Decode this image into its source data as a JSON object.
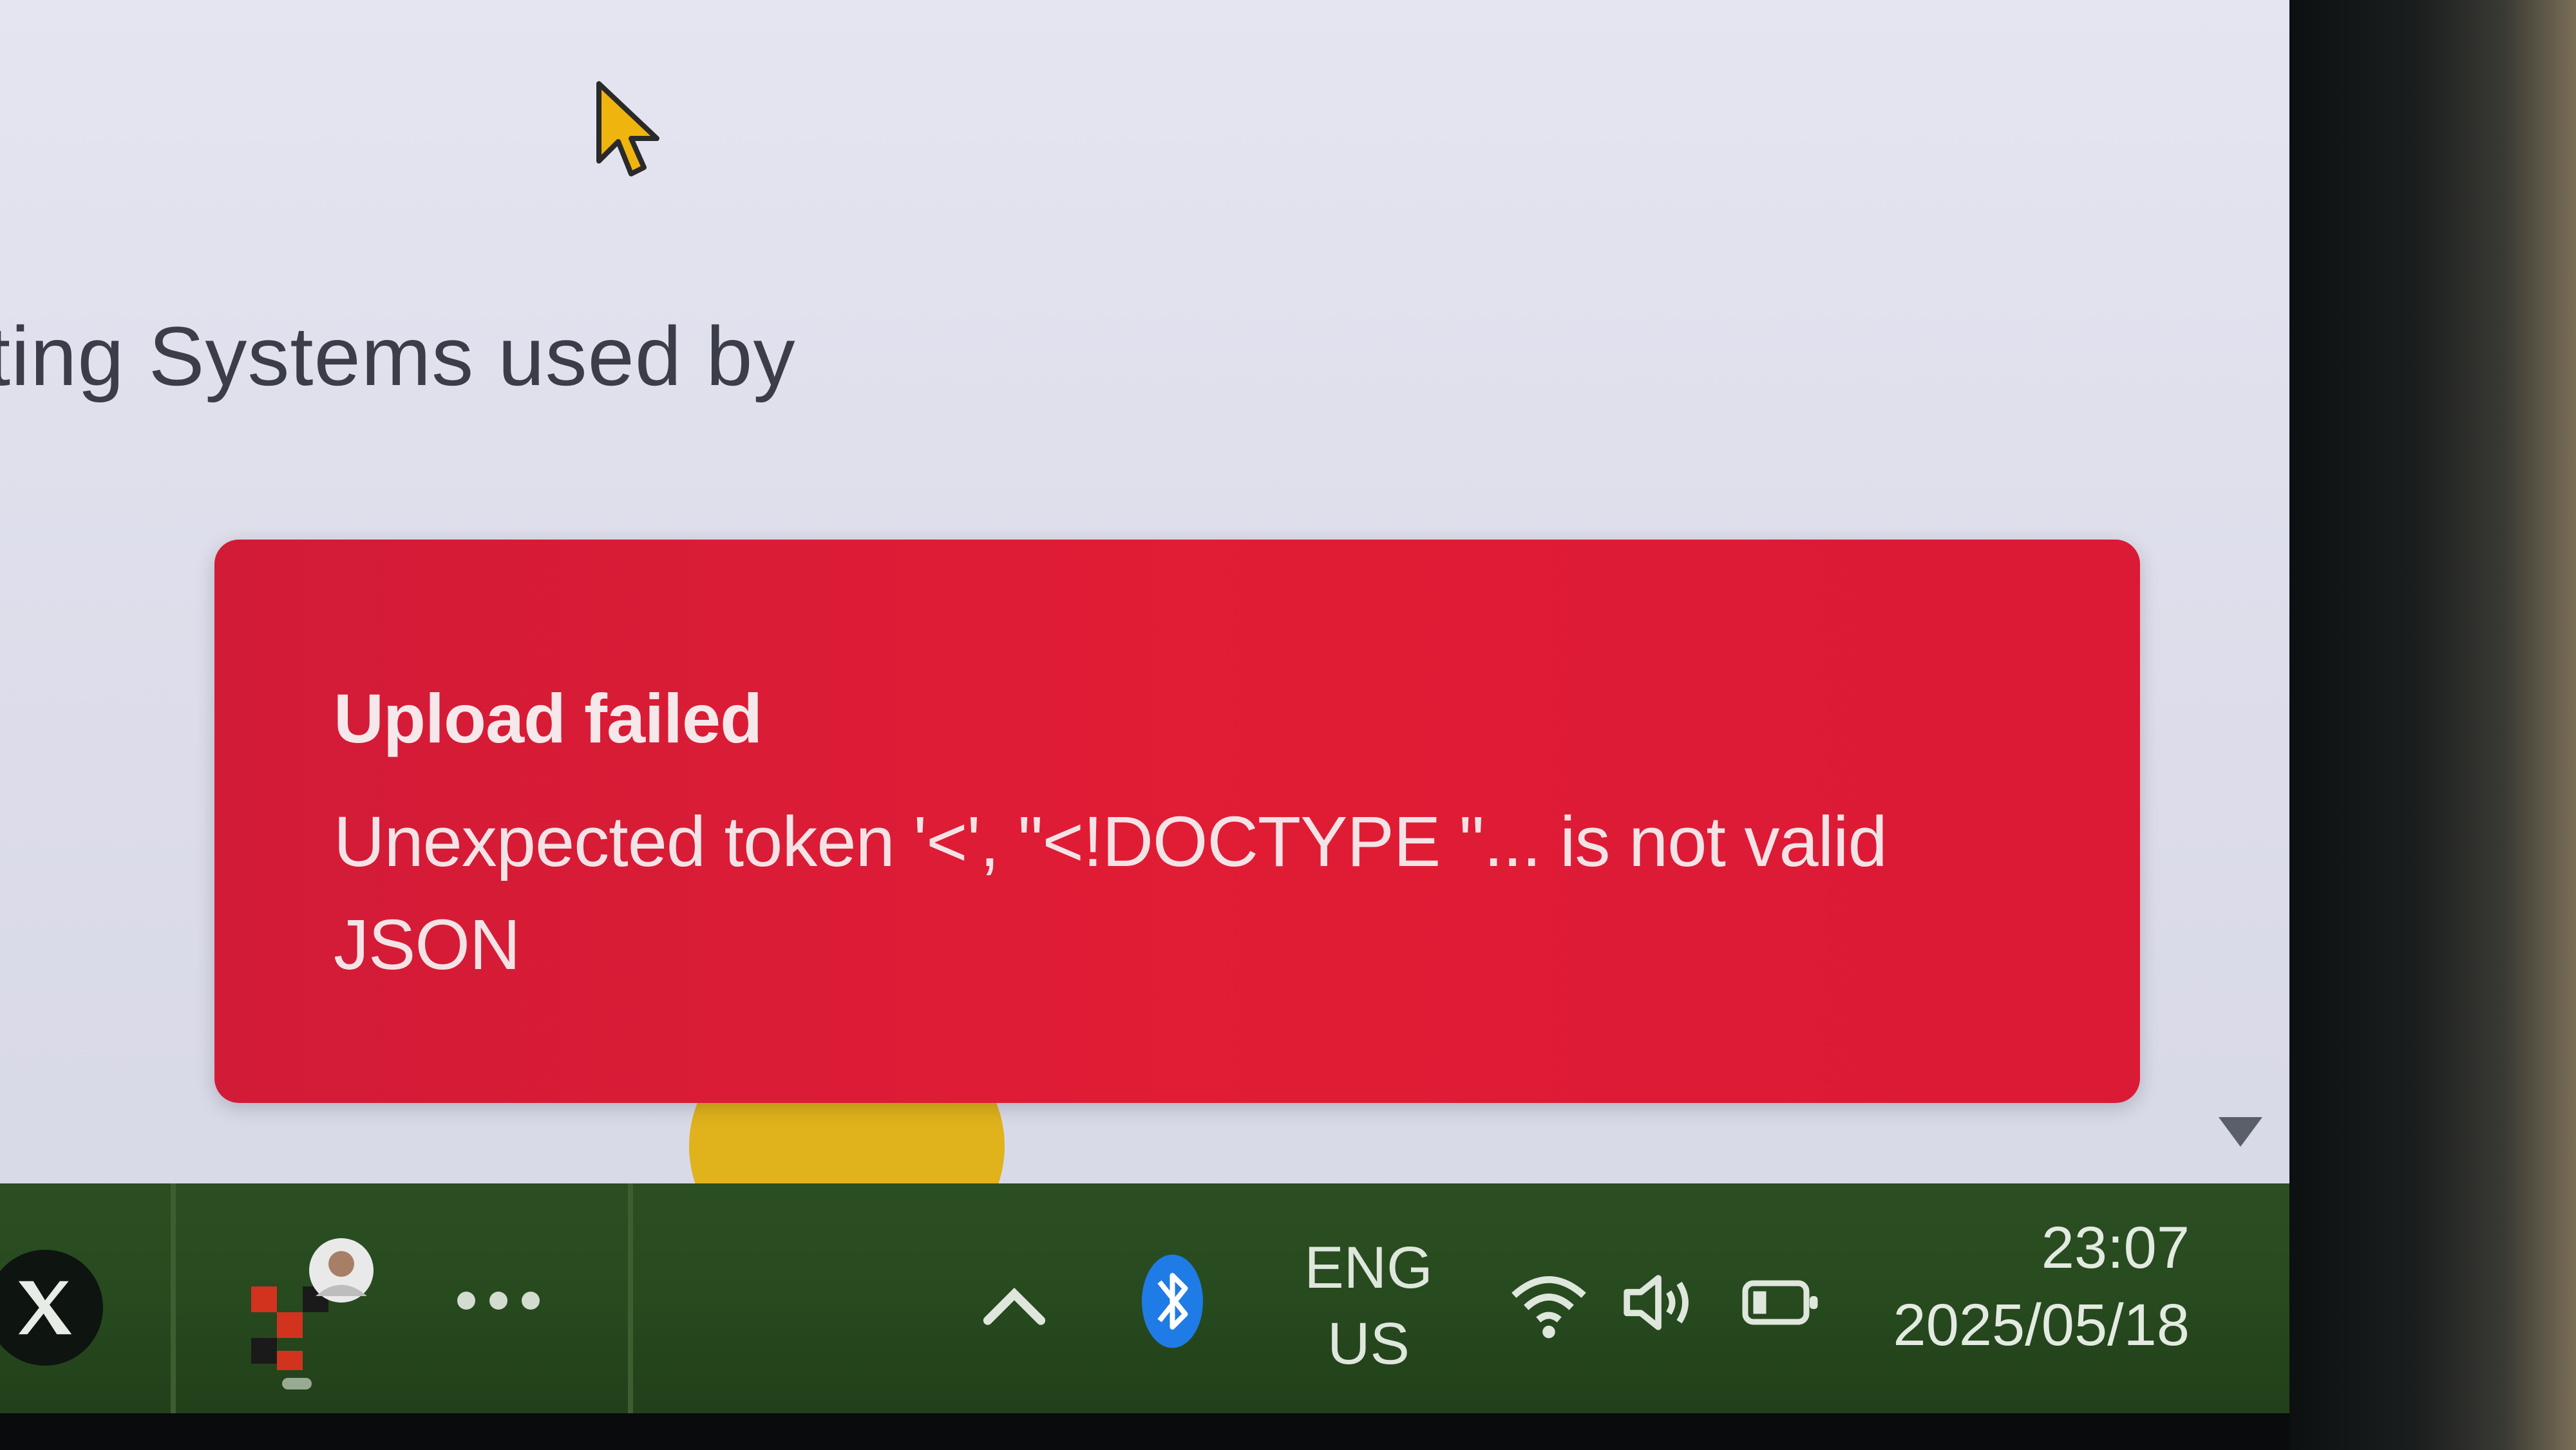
{
  "page": {
    "partial_heading": "ting Systems used by"
  },
  "toast": {
    "title": "Upload failed",
    "message": "Unexpected token '<', \"<!DOCTYPE \"... is not valid JSON",
    "background_color": "#e11c35",
    "text_color": "#f6e8ea"
  },
  "taskbar": {
    "background_color": "#274a1f",
    "apps": [
      {
        "icon": "x-app-icon"
      },
      {
        "icon": "app-with-avatar-icon",
        "active": true
      }
    ],
    "more_icon": "ellipsis-icon",
    "tray": {
      "overflow_icon": "chevron-up-icon",
      "bluetooth_icon": "bluetooth-icon",
      "language_line1": "ENG",
      "language_line2": "US",
      "wifi_icon": "wifi-icon",
      "volume_icon": "volume-icon",
      "battery_icon": "battery-icon"
    },
    "clock": {
      "time": "23:07",
      "date": "2025/05/18"
    }
  }
}
